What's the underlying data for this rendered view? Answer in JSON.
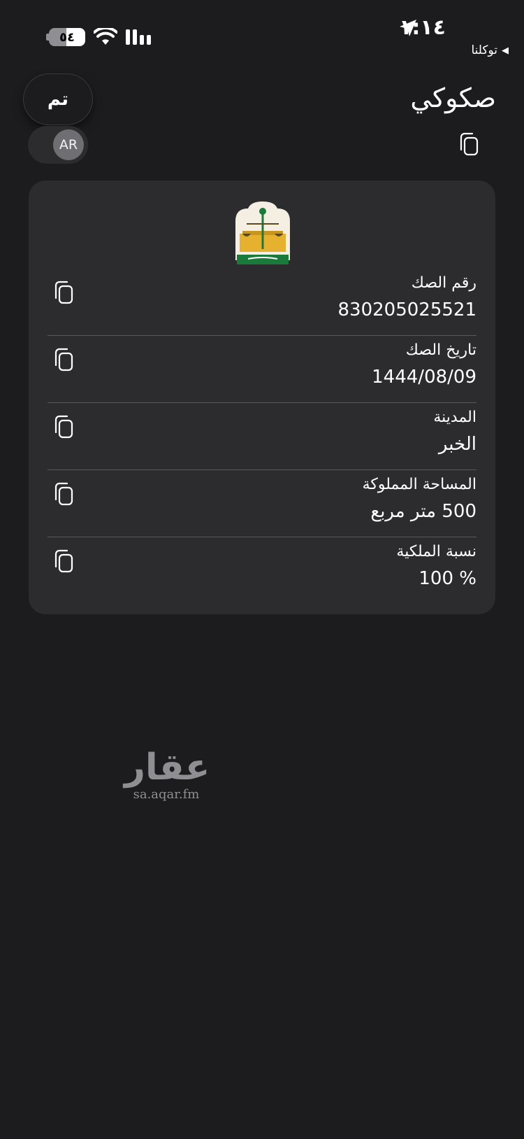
{
  "status_bar": {
    "time": "١:١٤",
    "battery": "٥٤",
    "back_app": "توكلنا",
    "back_arrow": "◀"
  },
  "header": {
    "title": "صكوكي",
    "done_label": "تم",
    "lang_label": "AR"
  },
  "card": {
    "emblem": "ministry-of-justice-emblem",
    "fields": [
      {
        "label": "رقم الصك",
        "value": "830205025521"
      },
      {
        "label": "تاريخ الصك",
        "value": "1444/08/09"
      },
      {
        "label": "المدينة",
        "value": "الخبر"
      },
      {
        "label": "المساحة المملوكة",
        "value": "500 متر مربع"
      },
      {
        "label": "نسبة الملكية",
        "value": "100 %"
      }
    ]
  },
  "watermark": {
    "logo_text": "عقار",
    "url": "sa.aqar.fm"
  },
  "colors": {
    "background": "#1c1c1e",
    "card": "#2c2c2e",
    "text": "#ffffff",
    "divider": "#5a5a5e",
    "emblem_green": "#1a7a3a",
    "emblem_gold": "#e6b12e"
  },
  "icons": {
    "copy": "copy-icon",
    "location": "location-arrow-icon",
    "wifi": "wifi-icon",
    "signal": "signal-icon"
  }
}
